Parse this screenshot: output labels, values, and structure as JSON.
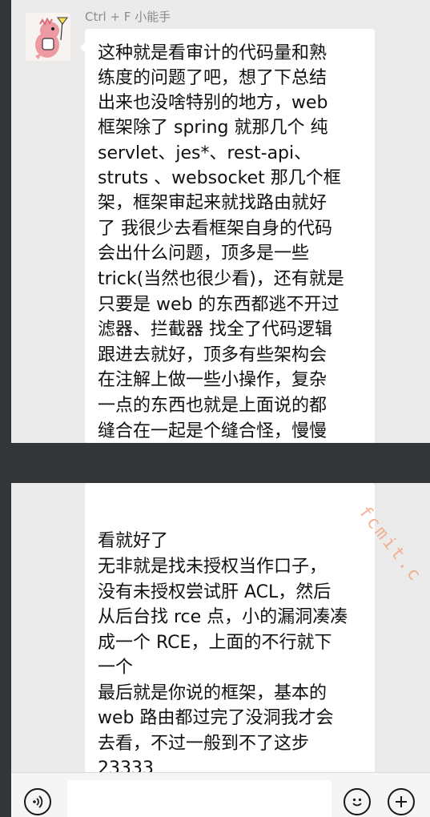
{
  "message_top": {
    "sender": "Ctrl + F 小能手",
    "lines": [
      "这种就是看审计的代码量和熟",
      "练度的问题了吧，想了下总结",
      "出来也没啥特别的地方，web",
      "框架除了 spring 就那几个 纯",
      "servlet、jes*、rest-api、",
      "struts 、websocket 那几个框",
      "架，框架审起来就找路由就好",
      "了 我很少去看框架自身的代码",
      "会出什么问题，顶多是一些",
      "trick(当然也很少看)，还有就是",
      "只要是 web 的东西都逃不开过",
      "滤器、拦截器 找全了代码逻辑",
      "跟进去就好，顶多有些架构会",
      "在注解上做一些小操作，复杂",
      "一点的东西也就是上面说的都",
      "缝合在一起是个缝合怪，慢慢"
    ]
  },
  "message_bottom": {
    "lines": [
      "看就好了",
      "无非就是找未授权当作口子，",
      "没有未授权尝试肝 ACL，然后",
      "从后台找 rce 点，小的漏洞凑凑",
      "成一个 RCE，上面的不行就下",
      "一个",
      "最后就是你说的框架，基本的",
      "web 路由都过完了没洞我才会",
      "去看，不过一般到不了这步",
      "23333"
    ]
  },
  "watermark": "fcmit.c",
  "input_bar": {
    "message_value": "",
    "voice_icon": "voice-icon",
    "emoji_icon": "emoji-icon",
    "plus_icon": "plus-icon"
  }
}
